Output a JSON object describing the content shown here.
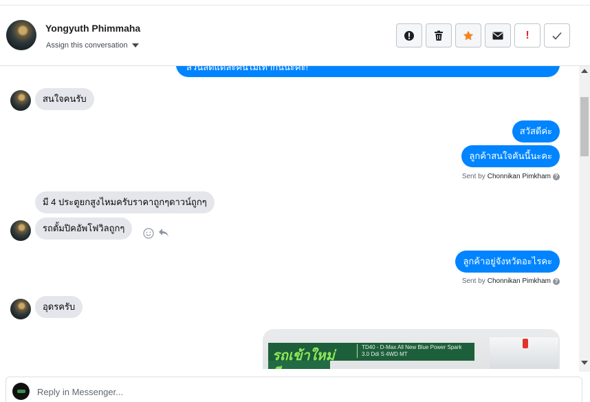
{
  "header": {
    "contact_name": "Yongyuth Phimmaha",
    "assign_label": "Assign this conversation",
    "actions": [
      {
        "icon": "alert-circle-icon",
        "glyph": "❗"
      },
      {
        "icon": "trash-icon",
        "glyph": "🗑"
      },
      {
        "icon": "star-icon",
        "glyph": "★"
      },
      {
        "icon": "envelope-icon",
        "glyph": "✉"
      },
      {
        "icon": "exclamation-icon",
        "glyph": "!"
      },
      {
        "icon": "checkmark-icon",
        "glyph": "✓"
      }
    ]
  },
  "messages": [
    {
      "dir": "out",
      "text": "ส่วนลดแต่ละคันไม่เท่ากันนะคะ!"
    },
    {
      "dir": "in",
      "text": "สนใจคนรับ"
    },
    {
      "dir": "out",
      "text": "สวัสดีค่ะ"
    },
    {
      "dir": "out",
      "text": "ลูกค้าสนใจคันนี้นะคะ"
    },
    {
      "sent_by_prefix": "Sent by",
      "sent_by_name": "Chonnikan Pimkham"
    },
    {
      "dir": "in",
      "text": "มี 4 ประตูยกสูงไหมครับราคาถูกๆดาวน์ถูกๆ"
    },
    {
      "dir": "in",
      "text": "รถตั้มปิคอัพโฟวิลถูกๆ"
    },
    {
      "dir": "out",
      "text": "ลูกค้าอยู่จังหวัดอะไรคะ"
    },
    {
      "sent_by_prefix": "Sent by",
      "sent_by_name": "Chonnikan Pimkham"
    },
    {
      "dir": "in",
      "text": "อุดรครับ"
    }
  ],
  "image_card": {
    "headline": "รถเข้าใหม่",
    "headline2": "ดีบอก",
    "spec_line1": "TD40 - D-Max All New Blue Power Spark",
    "spec_line2": "3.0 Ddi S 4WD MT"
  },
  "message_actions": {
    "react_icon": "smiley-icon",
    "reply_icon": "reply-arrow-icon"
  },
  "composer": {
    "placeholder": "Reply in Messenger..."
  },
  "colors": {
    "outgoing": "#0084ff",
    "incoming": "#e4e6eb",
    "star": "#f5821f",
    "alert_red": "#e4252c"
  }
}
